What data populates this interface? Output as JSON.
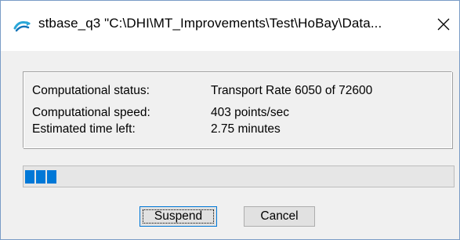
{
  "window": {
    "title": "stbase_q3 \"C:\\DHI\\MT_Improvements\\Test\\HoBay\\Data...",
    "app_icon": "dhi-wave-icon",
    "close_icon": "close-icon"
  },
  "status": {
    "rows": [
      {
        "label": "Computational status:",
        "value": "Transport Rate 6050 of 72600"
      },
      {
        "label": "Computational speed:",
        "value": "403 points/sec"
      },
      {
        "label": "Estimated time left:",
        "value": "2.75 minutes"
      }
    ]
  },
  "progress": {
    "fraction": 0.0833,
    "color": "#0078d7"
  },
  "buttons": {
    "suspend_label": "Suspend",
    "cancel_label": "Cancel"
  }
}
